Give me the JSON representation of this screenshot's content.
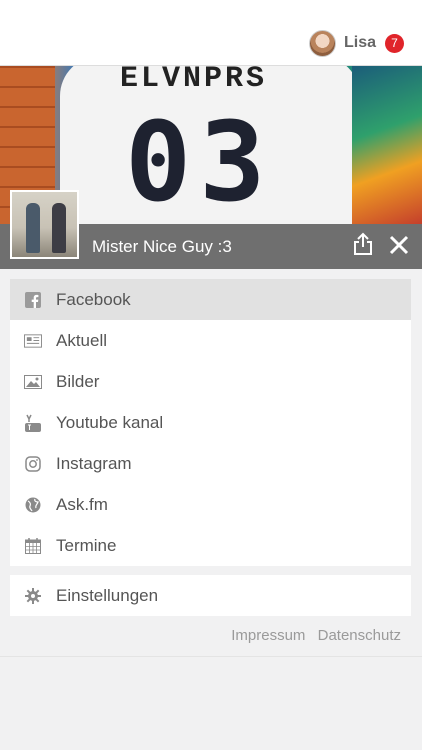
{
  "header": {
    "user_name": "Lisa",
    "notification_count": "7"
  },
  "hero": {
    "shirt_text": "ELVNPRS",
    "shirt_number": "03"
  },
  "profile": {
    "name": "Mister Nice Guy :3"
  },
  "menu": {
    "items": [
      {
        "label": "Facebook",
        "icon": "facebook-icon"
      },
      {
        "label": "Aktuell",
        "icon": "newspaper-icon"
      },
      {
        "label": "Bilder",
        "icon": "image-icon"
      },
      {
        "label": "Youtube kanal",
        "icon": "youtube-icon"
      },
      {
        "label": "Instagram",
        "icon": "instagram-icon"
      },
      {
        "label": "Ask.fm",
        "icon": "globe-icon"
      },
      {
        "label": "Termine",
        "icon": "calendar-icon"
      }
    ],
    "settings_label": "Einstellungen"
  },
  "footer": {
    "impressum": "Impressum",
    "datenschutz": "Datenschutz"
  },
  "colors": {
    "badge": "#e0242a",
    "active_item": "#e1e1e1",
    "profile_bar": "#6f6f6f"
  }
}
